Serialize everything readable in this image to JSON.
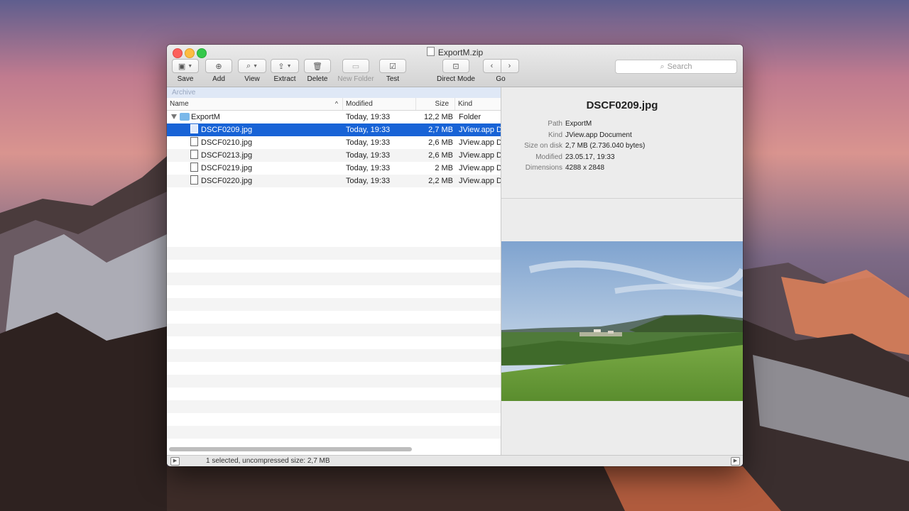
{
  "window": {
    "title": "ExportM.zip"
  },
  "toolbar": {
    "save": "Save",
    "add": "Add",
    "view": "View",
    "extract": "Extract",
    "delete": "Delete",
    "new_folder": "New Folder",
    "test": "Test",
    "direct_mode": "Direct Mode",
    "go": "Go"
  },
  "search": {
    "placeholder": "Search"
  },
  "archive": {
    "header": "Archive",
    "columns": {
      "name": "Name",
      "modified": "Modified",
      "size": "Size",
      "kind": "Kind"
    },
    "folder": {
      "name": "ExportM",
      "modified": "Today, 19:33",
      "size": "12,2 MB",
      "kind": "Folder"
    },
    "files": [
      {
        "name": "DSCF0209.jpg",
        "modified": "Today, 19:33",
        "size": "2,7 MB",
        "kind": "JView.app D"
      },
      {
        "name": "DSCF0210.jpg",
        "modified": "Today, 19:33",
        "size": "2,6 MB",
        "kind": "JView.app D"
      },
      {
        "name": "DSCF0213.jpg",
        "modified": "Today, 19:33",
        "size": "2,6 MB",
        "kind": "JView.app D"
      },
      {
        "name": "DSCF0219.jpg",
        "modified": "Today, 19:33",
        "size": "2 MB",
        "kind": "JView.app D"
      },
      {
        "name": "DSCF0220.jpg",
        "modified": "Today, 19:33",
        "size": "2,2 MB",
        "kind": "JView.app D"
      }
    ]
  },
  "preview": {
    "title": "DSCF0209.jpg",
    "info": [
      {
        "key": "Path",
        "value": "ExportM"
      },
      {
        "key": "Kind",
        "value": "JView.app Document"
      },
      {
        "key": "Size on disk",
        "value": "2,7 MB (2.736.040 bytes)"
      },
      {
        "key": "Modified",
        "value": "23.05.17, 19:33"
      },
      {
        "key": "Dimensions",
        "value": "4288 x 2848"
      }
    ]
  },
  "status": {
    "text": "1 selected, uncompressed size: 2,7 MB"
  },
  "colors": {
    "selection": "#1863d6",
    "folder": "#7ab8ea"
  }
}
